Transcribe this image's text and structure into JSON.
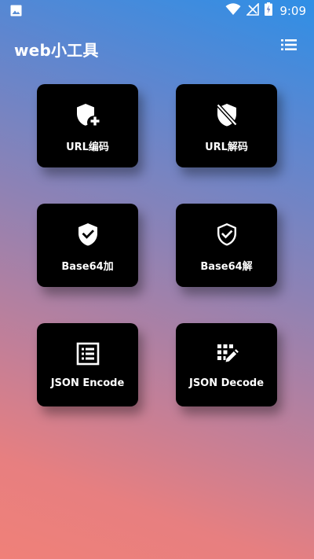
{
  "status_bar": {
    "time": "9:09",
    "left_icon": "image-icon",
    "right_icons": [
      "wifi-icon",
      "no-signal-icon",
      "battery-charging-icon"
    ]
  },
  "app": {
    "title": "web小工具",
    "menu_icon": "list-icon"
  },
  "tiles": [
    {
      "label": "URL编码",
      "icon": "shield-plus-icon"
    },
    {
      "label": "URL解码",
      "icon": "shield-off-icon"
    },
    {
      "label": "Base64加",
      "icon": "shield-check-filled-icon"
    },
    {
      "label": "Base64解",
      "icon": "shield-check-outline-icon"
    },
    {
      "label": "JSON Encode",
      "icon": "list-box-icon"
    },
    {
      "label": "JSON Decode",
      "icon": "grid-edit-icon"
    }
  ],
  "colors": {
    "tile_background": "#000000",
    "text": "#ffffff",
    "gradient_top": "#2f8fe6",
    "gradient_bottom": "#f08078"
  }
}
